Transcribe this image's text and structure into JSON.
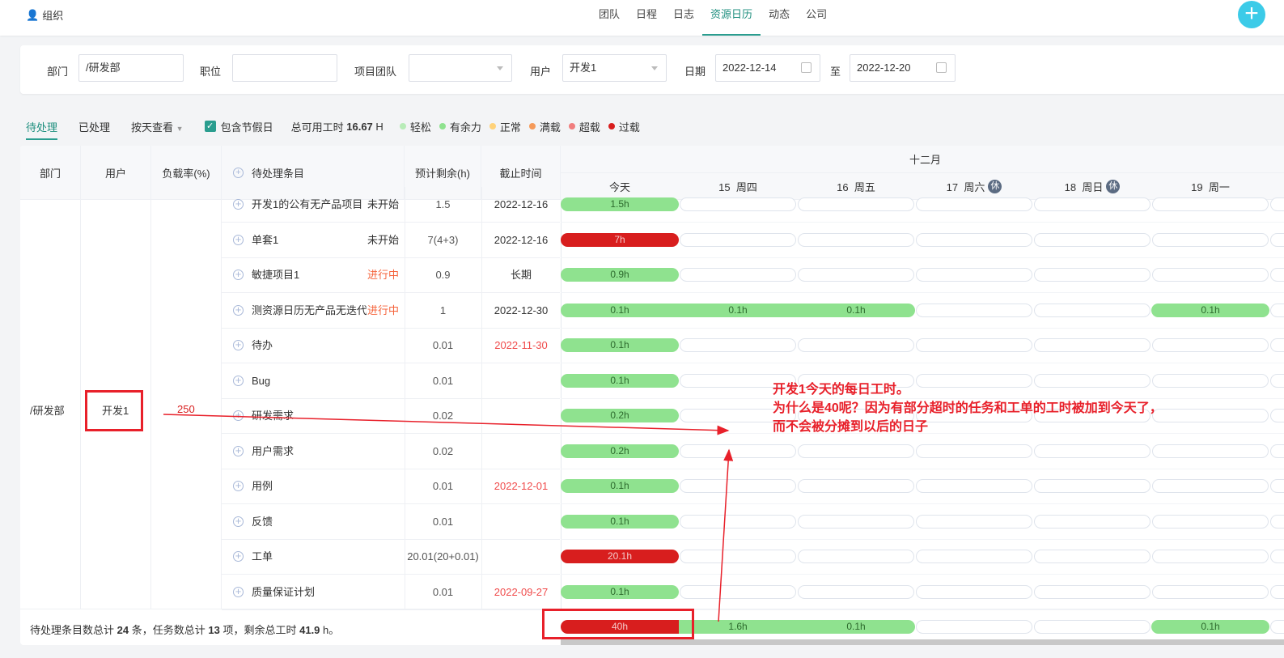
{
  "header": {
    "org": "组织",
    "nav": [
      "团队",
      "日程",
      "日志",
      "资源日历",
      "动态",
      "公司"
    ],
    "active_nav": "资源日历",
    "add_icon": "plus-icon"
  },
  "filters": {
    "dept_label": "部门",
    "dept_value": "/研发部",
    "position_label": "职位",
    "position_value": "",
    "team_label": "项目团队",
    "team_value": "",
    "user_label": "用户",
    "user_value": "开发1",
    "date_label": "日期",
    "date_from": "2022-12-14",
    "to_label": "至",
    "date_to": "2022-12-20"
  },
  "toolbar": {
    "tabs": [
      "待处理",
      "已处理"
    ],
    "view": "按天查看",
    "holiday_label": "包含节假日",
    "holiday_checked": true,
    "avail_label": "总可用工时",
    "avail_value": "16.67",
    "avail_unit": "H",
    "legend": [
      {
        "label": "轻松",
        "color": "#b8ecb8"
      },
      {
        "label": "有余力",
        "color": "#8fe28f"
      },
      {
        "label": "正常",
        "color": "#ffd27a"
      },
      {
        "label": "满载",
        "color": "#f59a5a"
      },
      {
        "label": "超载",
        "color": "#f07e7e"
      },
      {
        "label": "过载",
        "color": "#d81e1e"
      }
    ]
  },
  "table": {
    "headers": {
      "dept": "部门",
      "user": "用户",
      "load": "负载率(%)",
      "item": "待处理条目",
      "remain": "预计剩余(h)",
      "deadline": "截止时间",
      "month": "十二月"
    },
    "days": [
      {
        "label": "今天",
        "rest": ""
      },
      {
        "label": "15  周四",
        "rest": ""
      },
      {
        "label": "16  周五",
        "rest": ""
      },
      {
        "label": "17  周六",
        "rest": "休"
      },
      {
        "label": "18  周日",
        "rest": "休"
      },
      {
        "label": "19  周一",
        "rest": ""
      }
    ],
    "dept": "/研发部",
    "user": "开发1",
    "load": "250",
    "rows": [
      {
        "name": "开发1的公有无产品项目",
        "status": "未开始",
        "status_color": "#333",
        "remain": "1.5",
        "deadline": "2022-12-16",
        "overdue": false,
        "bars": [
          [
            "g",
            "1.5h"
          ],
          [
            "e",
            ""
          ],
          [
            "e",
            ""
          ],
          [
            "e",
            ""
          ],
          [
            "e",
            ""
          ],
          [
            "e",
            ""
          ]
        ]
      },
      {
        "name": "单套1",
        "status": "未开始",
        "status_color": "#333",
        "remain": "7(4+3)",
        "deadline": "2022-12-16",
        "overdue": false,
        "bars": [
          [
            "r",
            "7h"
          ],
          [
            "e",
            ""
          ],
          [
            "e",
            ""
          ],
          [
            "e",
            ""
          ],
          [
            "e",
            ""
          ],
          [
            "e",
            ""
          ]
        ]
      },
      {
        "name": "敏捷项目1",
        "status": "进行中",
        "status_color": "#f5643c",
        "remain": "0.9",
        "deadline": "长期",
        "overdue": false,
        "bars": [
          [
            "g",
            "0.9h"
          ],
          [
            "e",
            ""
          ],
          [
            "e",
            ""
          ],
          [
            "e",
            ""
          ],
          [
            "e",
            ""
          ],
          [
            "e",
            ""
          ]
        ]
      },
      {
        "name": "测资源日历无产品无迭代",
        "status": "进行中",
        "status_color": "#f5643c",
        "remain": "1",
        "deadline": "2022-12-30",
        "overdue": false,
        "bars": [
          [
            "g",
            "0.1h"
          ],
          [
            "g",
            "0.1h"
          ],
          [
            "g",
            "0.1h"
          ],
          [
            "e",
            ""
          ],
          [
            "e",
            ""
          ],
          [
            "g",
            "0.1h"
          ]
        ]
      },
      {
        "name": "待办",
        "status": "",
        "status_color": "#333",
        "remain": "0.01",
        "deadline": "2022-11-30",
        "overdue": true,
        "bars": [
          [
            "g",
            "0.1h"
          ],
          [
            "e",
            ""
          ],
          [
            "e",
            ""
          ],
          [
            "e",
            ""
          ],
          [
            "e",
            ""
          ],
          [
            "e",
            ""
          ]
        ]
      },
      {
        "name": "Bug",
        "status": "",
        "status_color": "#333",
        "remain": "0.01",
        "deadline": "",
        "overdue": false,
        "bars": [
          [
            "g",
            "0.1h"
          ],
          [
            "e",
            ""
          ],
          [
            "e",
            ""
          ],
          [
            "e",
            ""
          ],
          [
            "e",
            ""
          ],
          [
            "e",
            ""
          ]
        ]
      },
      {
        "name": "研发需求",
        "status": "",
        "status_color": "#333",
        "remain": "0.02",
        "deadline": "",
        "overdue": false,
        "bars": [
          [
            "g",
            "0.2h"
          ],
          [
            "e",
            ""
          ],
          [
            "e",
            ""
          ],
          [
            "e",
            ""
          ],
          [
            "e",
            ""
          ],
          [
            "e",
            ""
          ]
        ]
      },
      {
        "name": "用户需求",
        "status": "",
        "status_color": "#333",
        "remain": "0.02",
        "deadline": "",
        "overdue": false,
        "bars": [
          [
            "g",
            "0.2h"
          ],
          [
            "e",
            ""
          ],
          [
            "e",
            ""
          ],
          [
            "e",
            ""
          ],
          [
            "e",
            ""
          ],
          [
            "e",
            ""
          ]
        ]
      },
      {
        "name": "用例",
        "status": "",
        "status_color": "#333",
        "remain": "0.01",
        "deadline": "2022-12-01",
        "overdue": true,
        "bars": [
          [
            "g",
            "0.1h"
          ],
          [
            "e",
            ""
          ],
          [
            "e",
            ""
          ],
          [
            "e",
            ""
          ],
          [
            "e",
            ""
          ],
          [
            "e",
            ""
          ]
        ]
      },
      {
        "name": "反馈",
        "status": "",
        "status_color": "#333",
        "remain": "0.01",
        "deadline": "",
        "overdue": false,
        "bars": [
          [
            "g",
            "0.1h"
          ],
          [
            "e",
            ""
          ],
          [
            "e",
            ""
          ],
          [
            "e",
            ""
          ],
          [
            "e",
            ""
          ],
          [
            "e",
            ""
          ]
        ]
      },
      {
        "name": "工单",
        "status": "",
        "status_color": "#333",
        "remain": "20.01(20+0.01)",
        "deadline": "",
        "overdue": false,
        "bars": [
          [
            "r",
            "20.1h"
          ],
          [
            "e",
            ""
          ],
          [
            "e",
            ""
          ],
          [
            "e",
            ""
          ],
          [
            "e",
            ""
          ],
          [
            "e",
            ""
          ]
        ]
      },
      {
        "name": "质量保证计划",
        "status": "",
        "status_color": "#333",
        "remain": "0.01",
        "deadline": "2022-09-27",
        "overdue": true,
        "bars": [
          [
            "g",
            "0.1h"
          ],
          [
            "e",
            ""
          ],
          [
            "e",
            ""
          ],
          [
            "e",
            ""
          ],
          [
            "e",
            ""
          ],
          [
            "e",
            ""
          ]
        ]
      }
    ],
    "footer": {
      "t1": "待处理条目数总计",
      "items": "24",
      "t2": "条，任务数总计",
      "tasks": "13",
      "t3": "项，剩余总工时",
      "hours": "41.9",
      "t4": "h。",
      "bars": [
        [
          "r",
          "40h"
        ],
        [
          "g",
          "1.6h"
        ],
        [
          "g",
          "0.1h"
        ],
        [
          "e",
          ""
        ],
        [
          "e",
          ""
        ],
        [
          "g",
          "0.1h"
        ]
      ]
    }
  },
  "annotation": {
    "lines": [
      "开发1今天的每日工时。",
      "为什么是40呢？因为有部分超时的任务和工单的工时被加到今天了，",
      "而不会被分摊到以后的日子"
    ]
  }
}
